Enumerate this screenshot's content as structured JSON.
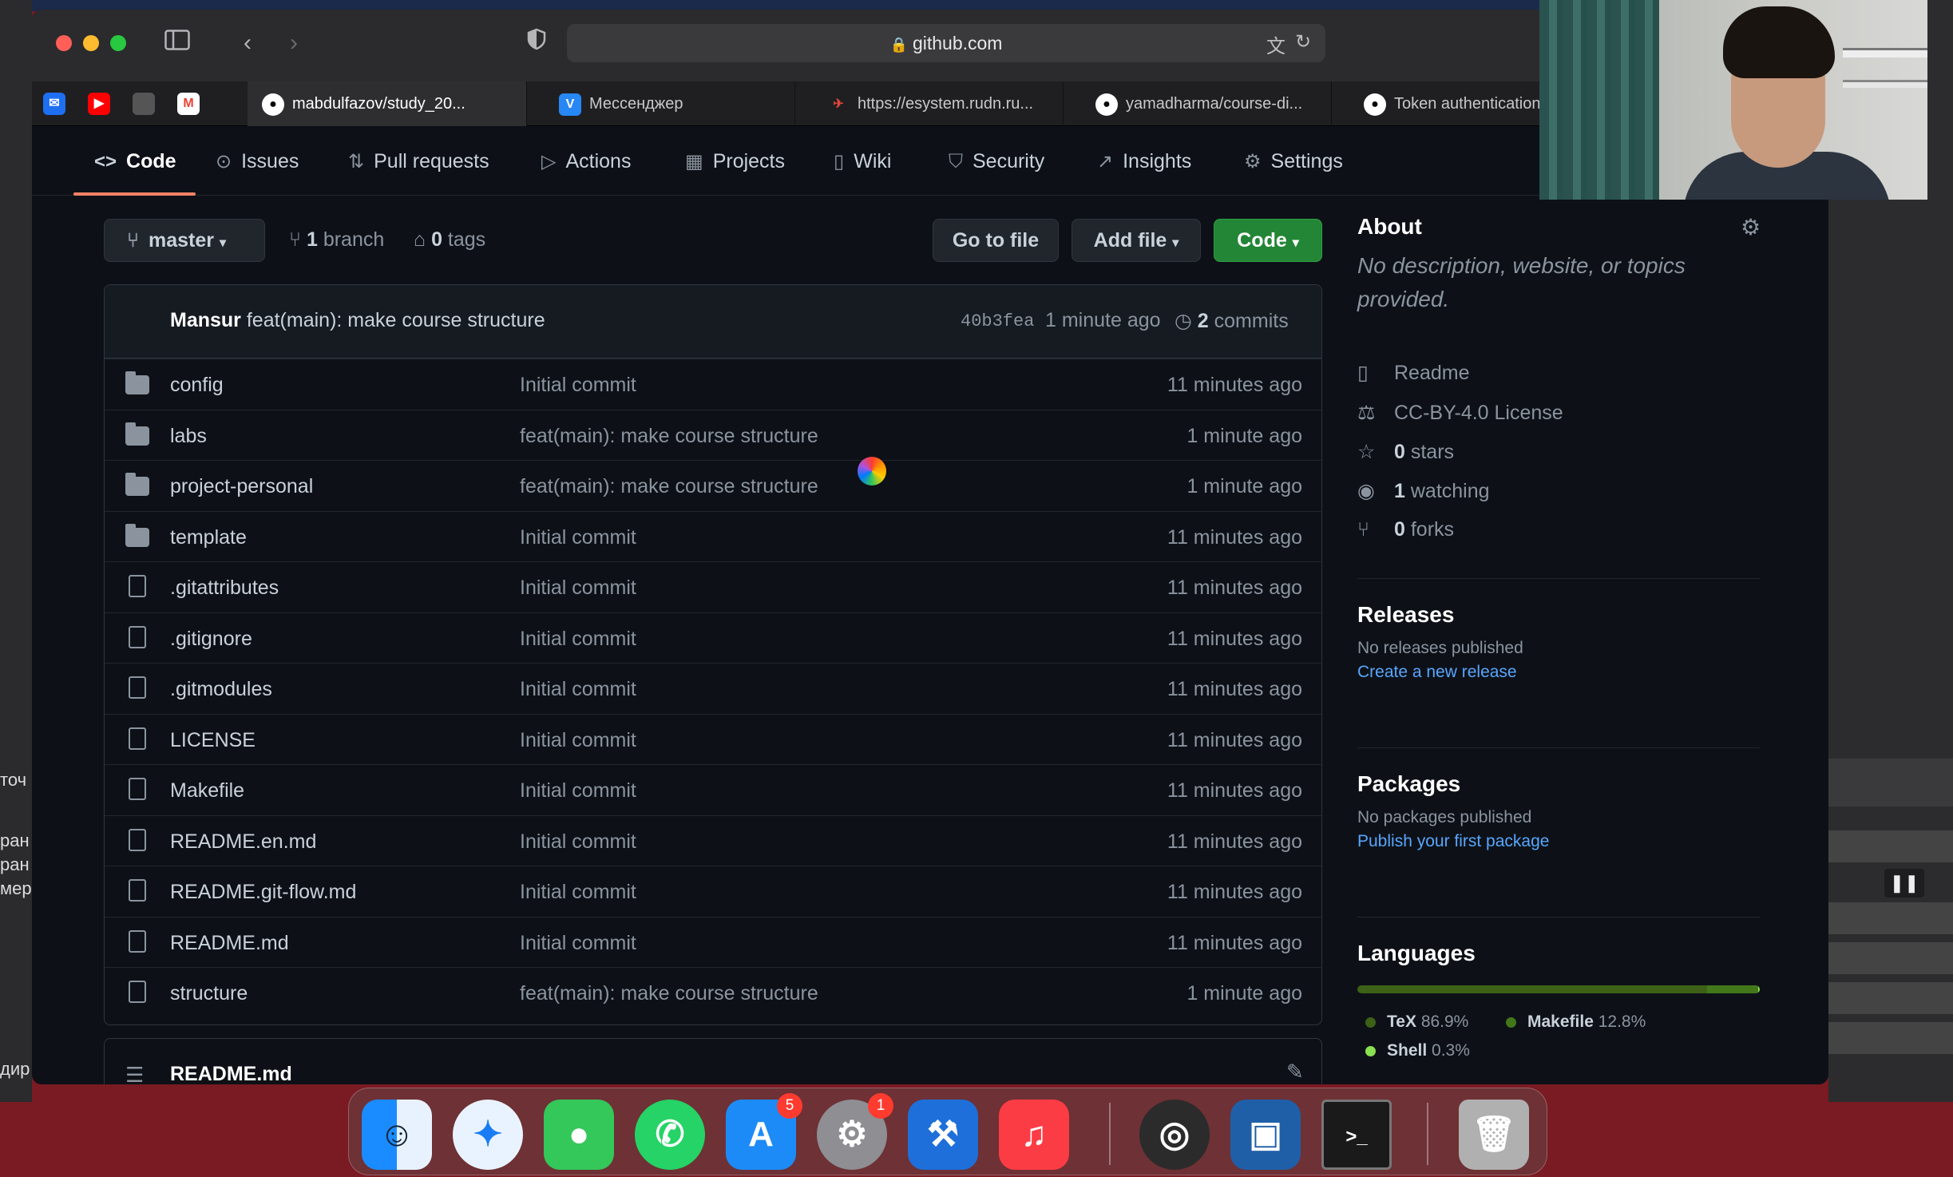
{
  "browser": {
    "url": "github.com",
    "tabs": [
      {
        "label": "mabdulfazov/study_20...",
        "favicon": "github-icon",
        "active": true
      },
      {
        "label": "Мессенджер",
        "favicon": "vk-icon",
        "active": false
      },
      {
        "label": "https://esystem.rudn.ru...",
        "favicon": "rudn-icon",
        "active": false
      },
      {
        "label": "yamadharma/course-di...",
        "favicon": "github-icon",
        "active": false
      },
      {
        "label": "Token authentication r...",
        "favicon": "github-icon",
        "active": false
      }
    ]
  },
  "repo_nav": {
    "items": [
      {
        "label": "Code",
        "icon": "code-icon",
        "active": true
      },
      {
        "label": "Issues",
        "icon": "issue-icon"
      },
      {
        "label": "Pull requests",
        "icon": "pull-request-icon"
      },
      {
        "label": "Actions",
        "icon": "play-icon"
      },
      {
        "label": "Projects",
        "icon": "table-icon"
      },
      {
        "label": "Wiki",
        "icon": "book-icon"
      },
      {
        "label": "Security",
        "icon": "shield-icon"
      },
      {
        "label": "Insights",
        "icon": "graph-icon"
      },
      {
        "label": "Settings",
        "icon": "gear-icon"
      }
    ]
  },
  "branch_bar": {
    "branch": "master",
    "branch_count": "1",
    "branch_label": "branch",
    "tag_count": "0",
    "tag_label": "tags",
    "go_to_file": "Go to file",
    "add_file": "Add file",
    "code": "Code"
  },
  "last_commit": {
    "author": "Mansur",
    "message": "feat(main): make course structure",
    "sha": "40b3fea",
    "time": "1 minute ago",
    "commit_count": "2",
    "commit_label": "commits"
  },
  "files": [
    {
      "name": "config",
      "type": "dir",
      "commit": "Initial commit",
      "time": "11 minutes ago"
    },
    {
      "name": "labs",
      "type": "dir",
      "commit": "feat(main): make course structure",
      "time": "1 minute ago"
    },
    {
      "name": "project-personal",
      "type": "dir",
      "commit": "feat(main): make course structure",
      "time": "1 minute ago"
    },
    {
      "name": "template",
      "type": "dir",
      "commit": "Initial commit",
      "time": "11 minutes ago"
    },
    {
      "name": ".gitattributes",
      "type": "file",
      "commit": "Initial commit",
      "time": "11 minutes ago"
    },
    {
      "name": ".gitignore",
      "type": "file",
      "commit": "Initial commit",
      "time": "11 minutes ago"
    },
    {
      "name": ".gitmodules",
      "type": "file",
      "commit": "Initial commit",
      "time": "11 minutes ago"
    },
    {
      "name": "LICENSE",
      "type": "file",
      "commit": "Initial commit",
      "time": "11 minutes ago"
    },
    {
      "name": "Makefile",
      "type": "file",
      "commit": "Initial commit",
      "time": "11 minutes ago"
    },
    {
      "name": "README.en.md",
      "type": "file",
      "commit": "Initial commit",
      "time": "11 minutes ago"
    },
    {
      "name": "README.git-flow.md",
      "type": "file",
      "commit": "Initial commit",
      "time": "11 minutes ago"
    },
    {
      "name": "README.md",
      "type": "file",
      "commit": "Initial commit",
      "time": "11 minutes ago"
    },
    {
      "name": "structure",
      "type": "file",
      "commit": "feat(main): make course structure",
      "time": "1 minute ago"
    }
  ],
  "readme_header": "README.md",
  "about": {
    "title": "About",
    "description": "No description, website, or topics provided.",
    "readme": "Readme",
    "license": "CC-BY-4.0 License",
    "stars_count": "0",
    "stars_label": "stars",
    "watching_count": "1",
    "watching_label": "watching",
    "forks_count": "0",
    "forks_label": "forks"
  },
  "releases": {
    "title": "Releases",
    "empty": "No releases published",
    "link": "Create a new release"
  },
  "packages": {
    "title": "Packages",
    "empty": "No packages published",
    "link": "Publish your first package"
  },
  "languages": {
    "title": "Languages",
    "items": [
      {
        "name": "TeX",
        "percent": "86.9%",
        "value": 86.9,
        "color": "#3d6117"
      },
      {
        "name": "Makefile",
        "percent": "12.8%",
        "value": 12.8,
        "color": "#427819"
      },
      {
        "name": "Shell",
        "percent": "0.3%",
        "value": 0.3,
        "color": "#89e051"
      }
    ]
  },
  "dock": {
    "apps": [
      {
        "name": "finder-icon"
      },
      {
        "name": "safari-icon"
      },
      {
        "name": "messages-icon"
      },
      {
        "name": "whatsapp-icon"
      },
      {
        "name": "app-store-icon",
        "badge": "5"
      },
      {
        "name": "system-preferences-icon",
        "badge": "1"
      },
      {
        "name": "xcode-icon"
      },
      {
        "name": "music-icon"
      },
      {
        "name": "obs-icon"
      },
      {
        "name": "virtualbox-icon"
      },
      {
        "name": "terminal-icon"
      },
      {
        "name": "trash-icon"
      }
    ]
  },
  "background_fragments": [
    "точ",
    "ран",
    "ран",
    "мер",
    "дир"
  ]
}
